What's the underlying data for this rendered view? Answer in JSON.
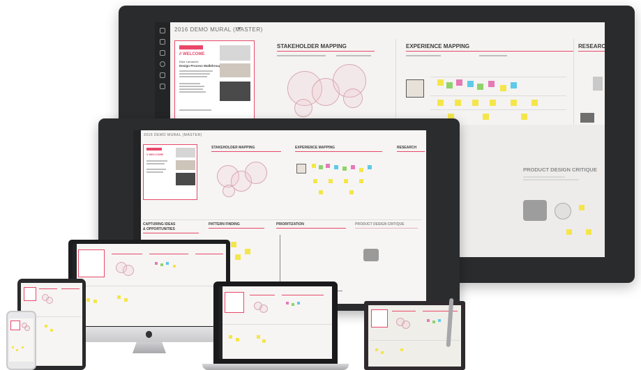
{
  "app": {
    "board_title": "2016 DEMO MURAL (MASTER)",
    "menu_icon": "chevron-down-icon"
  },
  "sections": {
    "welcome": "// WELCOME",
    "stakeholder_mapping": "STAKEHOLDER MAPPING",
    "experience_mapping": "EXPERIENCE MAPPING",
    "research": "RESEARCH",
    "product_design_critique": "PRODUCT DESIGN CRITIQUE",
    "capturing_ideas": "CAPTURING IDEAS",
    "capturing_ideas_2": "& OPPORTUNITIES",
    "pattern_finding": "PATTERN FINDING",
    "prioritization": "PRIORITIZATION"
  },
  "welcome_card": {
    "author": "Elsie Lamarche",
    "subtitle": "Design Process Walkthrough"
  },
  "devices": [
    "surface-hub-large",
    "surface-hub-medium",
    "imac",
    "macbook",
    "ipad",
    "iphone",
    "surface-pro"
  ],
  "colors": {
    "accent": "#e8476a",
    "sticky_yellow": "#f4e64a",
    "sticky_green": "#8fd36b",
    "sticky_pink": "#e57ab5",
    "sticky_blue": "#5fc9e8",
    "bezel": "#2a2b2d"
  }
}
